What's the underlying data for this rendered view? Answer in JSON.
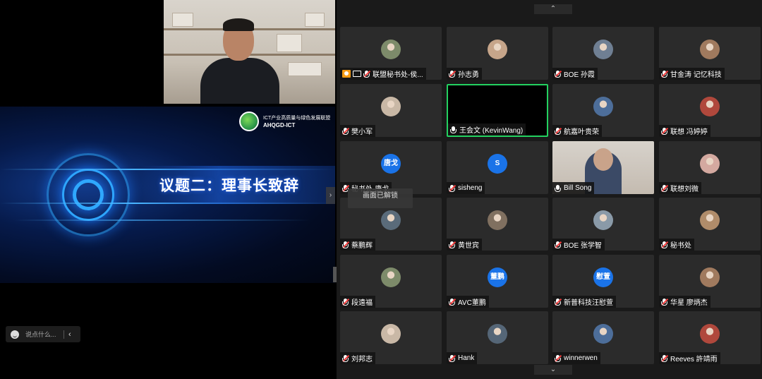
{
  "slide": {
    "title": "议题二：理事长致辞",
    "org_name": "ICT产业高质量与绿色发展联盟",
    "org_code": "AHQGD-ICT",
    "next_glyph": "›"
  },
  "chat": {
    "placeholder": "说点什么...",
    "collapse_glyph": "‹"
  },
  "grid": {
    "scroll_up_glyph": "⌃",
    "scroll_down_glyph": "⌄",
    "unlock_tip": "画面已解锁",
    "accent_active": "#23d160",
    "avatar_initial_color": "#1a73e8",
    "participants": [
      {
        "name": "联盟秘书处-侯...",
        "avatar": "photo",
        "muted": true,
        "host": true
      },
      {
        "name": "孙志勇",
        "avatar": "photo",
        "muted": true
      },
      {
        "name": "BOE 孙霞",
        "avatar": "photo",
        "muted": true
      },
      {
        "name": "甘金涛 记忆科技",
        "avatar": "photo",
        "muted": true
      },
      {
        "name": "樊小军",
        "avatar": "photo",
        "muted": true
      },
      {
        "name": "王会文 (KevinWang)",
        "avatar": "none",
        "muted": false,
        "active": true
      },
      {
        "name": "航嘉叶贵荣",
        "avatar": "photo",
        "muted": true
      },
      {
        "name": "联想 冯婷婷",
        "avatar": "photo",
        "muted": true
      },
      {
        "name": "秘书处-唐戈",
        "avatar": "initials",
        "initials": "唐戈",
        "muted": true
      },
      {
        "name": "sisheng",
        "avatar": "initials",
        "initials": "S",
        "muted": true
      },
      {
        "name": "Bill Song",
        "avatar": "video",
        "muted": false
      },
      {
        "name": "联想刘微",
        "avatar": "photo",
        "muted": true
      },
      {
        "name": "蔡鹏辉",
        "avatar": "photo",
        "muted": true
      },
      {
        "name": "黄世宾",
        "avatar": "photo",
        "muted": true
      },
      {
        "name": "BOE 张学智",
        "avatar": "photo",
        "muted": true
      },
      {
        "name": "秘书处",
        "avatar": "photo",
        "muted": true
      },
      {
        "name": "段遠福",
        "avatar": "photo",
        "muted": true
      },
      {
        "name": "AVC董鹏",
        "avatar": "initials",
        "initials": "董鹏",
        "muted": true
      },
      {
        "name": "新普科技汪慰萱",
        "avatar": "initials",
        "initials": "慰萱",
        "muted": true
      },
      {
        "name": "华星 廖炳杰",
        "avatar": "photo",
        "muted": true
      },
      {
        "name": "刘邦志",
        "avatar": "photo",
        "muted": true
      },
      {
        "name": "Hank",
        "avatar": "photo",
        "muted": true
      },
      {
        "name": "winnerwen",
        "avatar": "photo",
        "muted": true
      },
      {
        "name": "Reeves 許靖雨",
        "avatar": "photo",
        "muted": true
      }
    ]
  }
}
